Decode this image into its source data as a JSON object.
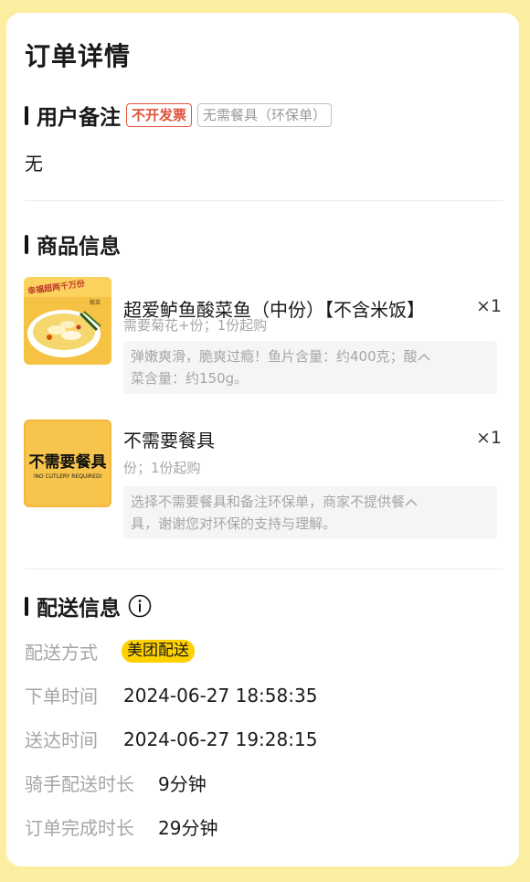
{
  "page_title": "订单详情",
  "remark": {
    "title": "用户备注",
    "tag_invoice": "不开发票",
    "tag_cutlery": "无需餐具（环保单）",
    "content": "无"
  },
  "goods": {
    "title": "商品信息",
    "items": [
      {
        "name": "超爱鲈鱼酸菜鱼（中份）【不含米饭】",
        "qty": "×1",
        "sub": "需要菊花+份；1份起购",
        "desc_line1": "弹嫩爽滑，脆爽过瘾！鱼片含量：约400克；酸",
        "desc_line2": "菜含量：约150g。",
        "image_banner": "幸福超两千万份",
        "image_logo": "酸菜"
      },
      {
        "name": "不需要餐具",
        "qty": "×1",
        "sub": "份；1份起购",
        "desc_line1": "选择不需要餐具和备注环保单，商家不提供餐",
        "desc_line2": "具，谢谢您对环保的支持与理解。",
        "image_title": "不需要餐具",
        "image_subtitle": "!NO CUTLERY REQUIRED!"
      }
    ]
  },
  "delivery": {
    "title": "配送信息",
    "info_icon": "info-icon",
    "rows": [
      {
        "label": "配送方式",
        "value": "美团配送"
      },
      {
        "label": "下单时间",
        "value": "2024-06-27 18:58:35"
      },
      {
        "label": "送达时间",
        "value": "2024-06-27 19:28:15"
      },
      {
        "label": "骑手配送时长",
        "value": "9分钟"
      },
      {
        "label": "订单完成时长",
        "value": "29分钟"
      }
    ]
  },
  "colors": {
    "page_bg": "#fbeea0",
    "accent_yellow": "#ffd100",
    "tag_red": "#e0533c"
  }
}
